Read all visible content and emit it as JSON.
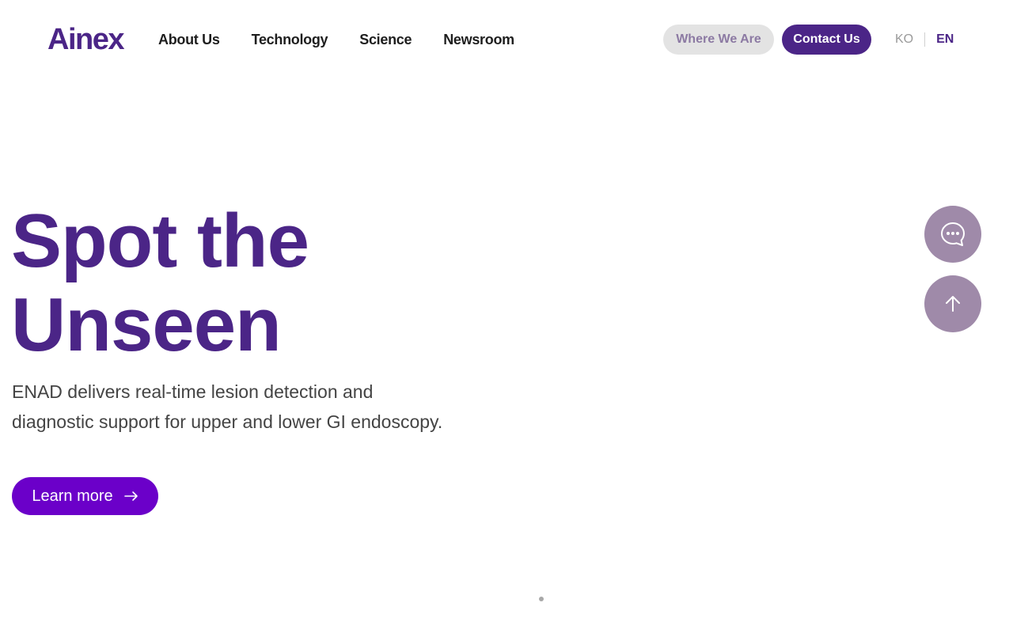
{
  "brand": {
    "logo_text": "Ainex",
    "primary_color": "#4b2587",
    "accent_color": "#6b00c9"
  },
  "nav": {
    "items": [
      {
        "label": "About Us"
      },
      {
        "label": "Technology"
      },
      {
        "label": "Science"
      },
      {
        "label": "Newsroom"
      }
    ]
  },
  "header_actions": {
    "where_label": "Where We Are",
    "contact_label": "Contact Us"
  },
  "language": {
    "ko": "KO",
    "en": "EN",
    "active": "EN"
  },
  "hero": {
    "title_line1": "Spot the",
    "title_line2": "Unseen",
    "desc_line1": "ENAD delivers real-time lesion detection and",
    "desc_line2": "diagnostic support for upper and lower GI endoscopy.",
    "cta_label": "Learn more",
    "cta_icon": "arrow-right-icon"
  },
  "floating_buttons": {
    "chat_icon": "chat-bubble-icon",
    "top_icon": "arrow-up-icon",
    "color": "#9f8aa9"
  },
  "carousel": {
    "total_slides": 1,
    "active_slide": 1
  }
}
